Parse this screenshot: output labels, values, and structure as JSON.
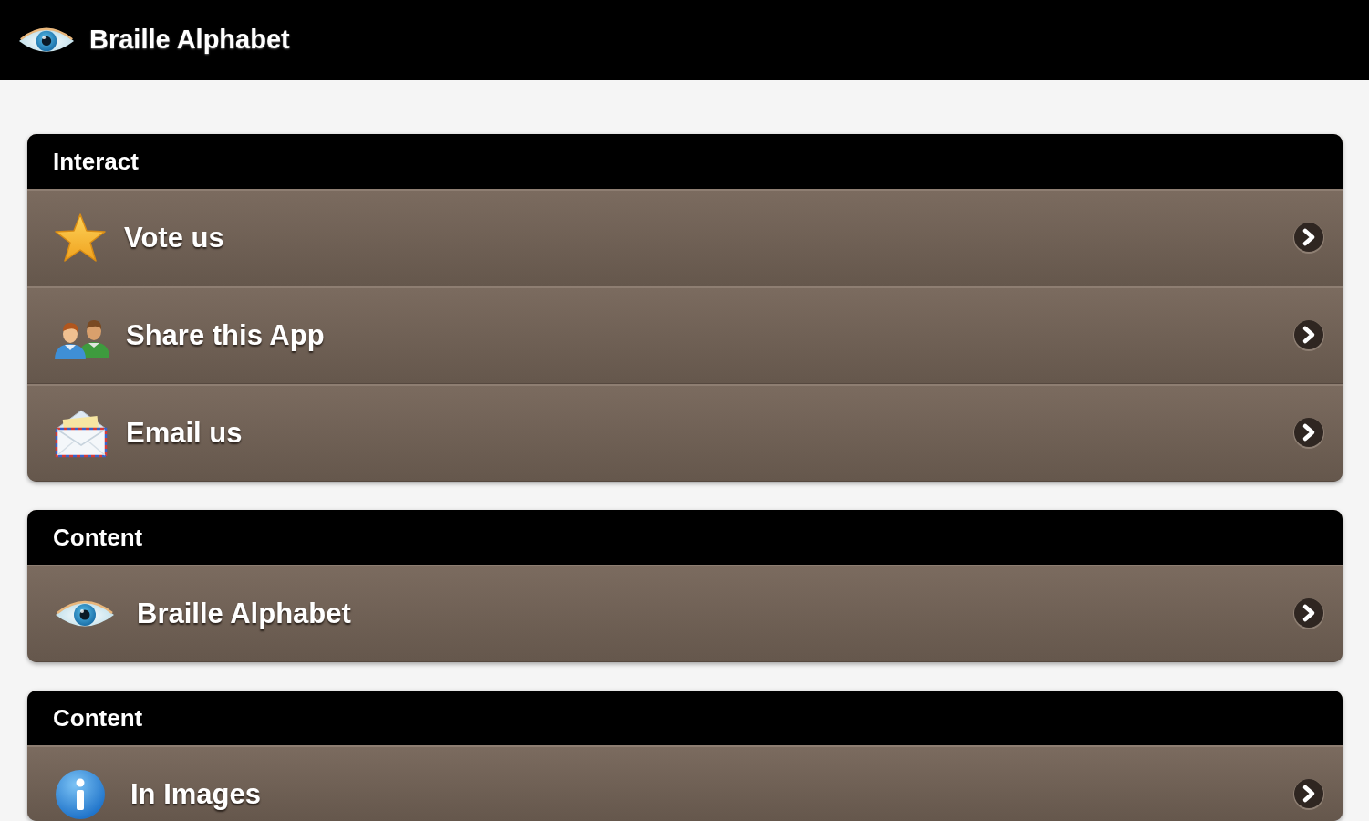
{
  "app_bar": {
    "title": "Braille Alphabet"
  },
  "sections": [
    {
      "title": "Interact",
      "items": [
        {
          "label": "Vote us"
        },
        {
          "label": "Share this App"
        },
        {
          "label": "Email us"
        }
      ]
    },
    {
      "title": "Content",
      "items": [
        {
          "label": "Braille Alphabet"
        }
      ]
    },
    {
      "title": "Content",
      "items": [
        {
          "label": "In Images"
        }
      ]
    }
  ]
}
